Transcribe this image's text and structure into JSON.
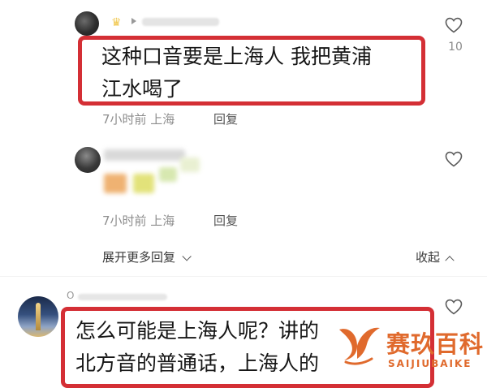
{
  "comments": [
    {
      "text_line1": "这种口音要是上海人 我把黄浦",
      "text_line2": "江水喝了",
      "time_location": "7小时前 上海",
      "reply_label": "回复",
      "likes": "10"
    },
    {
      "time_location": "7小时前 上海",
      "reply_label": "回复"
    },
    {
      "username_fragment": "O",
      "text_line1": "怎么可能是上海人呢？讲的",
      "text_line2": "北方音的普通话，上海人的"
    }
  ],
  "thread": {
    "expand_label": "展开更多回复",
    "collapse_label": "收起"
  },
  "watermark": {
    "title": "赛玖百科",
    "subtitle": "SAIJIUBAIKE",
    "color": "#e06a2d"
  },
  "colors": {
    "highlight_box": "#d42f35",
    "meta_text": "#8d8d8d"
  },
  "icons": {
    "like": "heart-outline-icon",
    "expand": "chevron-down-icon",
    "collapse": "chevron-up-icon"
  }
}
